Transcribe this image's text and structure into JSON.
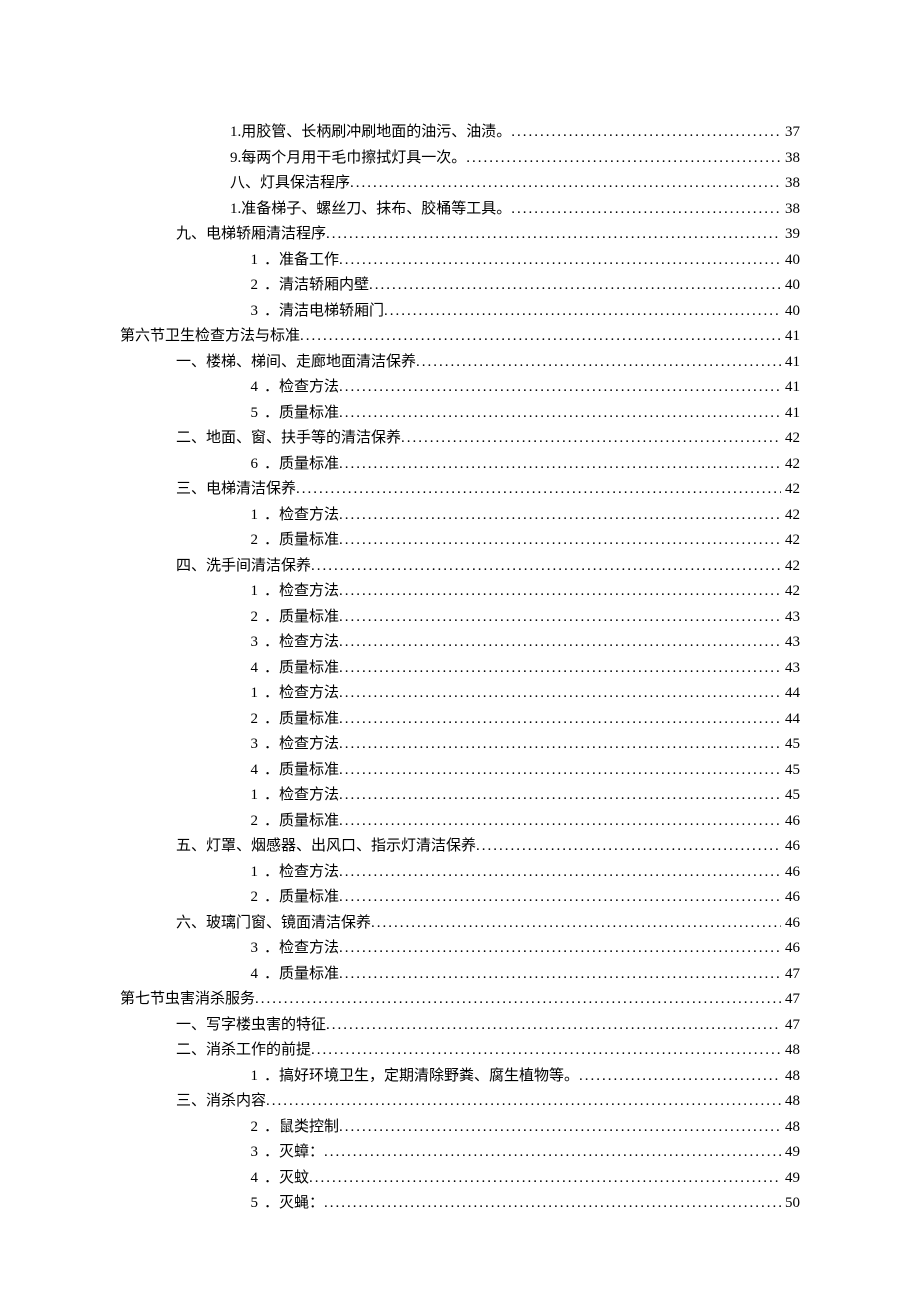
{
  "toc": [
    {
      "level": "lv2",
      "num": "",
      "label": "1.用胶管、长柄刷冲刷地面的油污、油渍。",
      "page": "37"
    },
    {
      "level": "lv2",
      "num": "",
      "label": "9.每两个月用干毛巾擦拭灯具一次。",
      "page": "38"
    },
    {
      "level": "lv2",
      "num": "",
      "label": "八、灯具保洁程序",
      "page": "38"
    },
    {
      "level": "lv2",
      "num": "",
      "label": "1.准备梯子、螺丝刀、抹布、胶桶等工具。",
      "page": "38"
    },
    {
      "level": "lv1",
      "num": "",
      "label": "九、电梯轿厢清洁程序",
      "page": "39"
    },
    {
      "level": "lv2n",
      "num": "1",
      "label": "．准备工作",
      "page": "40"
    },
    {
      "level": "lv2n",
      "num": "2",
      "label": "．清洁轿厢内壁",
      "page": "40"
    },
    {
      "level": "lv2n",
      "num": "3",
      "label": "．清洁电梯轿厢门",
      "page": "40"
    },
    {
      "level": "lv0",
      "num": "",
      "label": "第六节卫生检查方法与标准",
      "page": "41"
    },
    {
      "level": "lv1",
      "num": "",
      "label": "一、楼梯、梯间、走廊地面清洁保养",
      "page": "41"
    },
    {
      "level": "lv2n",
      "num": "4",
      "label": "．检查方法",
      "page": "41"
    },
    {
      "level": "lv2n",
      "num": "5",
      "label": "．质量标准",
      "page": "41"
    },
    {
      "level": "lv1",
      "num": "",
      "label": "二、地面、窗、扶手等的清洁保养",
      "page": "42"
    },
    {
      "level": "lv2n",
      "num": "6",
      "label": "．质量标准",
      "page": "42"
    },
    {
      "level": "lv1",
      "num": "",
      "label": "三、电梯清洁保养",
      "page": "42"
    },
    {
      "level": "lv2n",
      "num": "1",
      "label": "．检查方法",
      "page": "42"
    },
    {
      "level": "lv2n",
      "num": "2",
      "label": "．质量标准",
      "page": "42"
    },
    {
      "level": "lv1",
      "num": "",
      "label": "四、洗手间清洁保养",
      "page": "42"
    },
    {
      "level": "lv2n",
      "num": "1",
      "label": "．检查方法",
      "page": "42"
    },
    {
      "level": "lv2n",
      "num": "2",
      "label": "．质量标准",
      "page": "43"
    },
    {
      "level": "lv2n",
      "num": "3",
      "label": "．检查方法",
      "page": "43"
    },
    {
      "level": "lv2n",
      "num": "4",
      "label": "．质量标准",
      "page": "43"
    },
    {
      "level": "lv2n",
      "num": "1",
      "label": "．检查方法",
      "page": "44"
    },
    {
      "level": "lv2n",
      "num": "2",
      "label": "．质量标准",
      "page": "44"
    },
    {
      "level": "lv2n",
      "num": "3",
      "label": "．检查方法",
      "page": "45"
    },
    {
      "level": "lv2n",
      "num": "4",
      "label": "．质量标准",
      "page": "45"
    },
    {
      "level": "lv2n",
      "num": "1",
      "label": "．检查方法",
      "page": "45"
    },
    {
      "level": "lv2n",
      "num": "2",
      "label": "．质量标准",
      "page": "46"
    },
    {
      "level": "lv1",
      "num": "",
      "label": "五、灯罩、烟感器、出风口、指示灯清洁保养",
      "page": "46"
    },
    {
      "level": "lv2n",
      "num": "1",
      "label": "．检查方法",
      "page": "46"
    },
    {
      "level": "lv2n",
      "num": "2",
      "label": "．质量标准",
      "page": "46"
    },
    {
      "level": "lv1",
      "num": "",
      "label": "六、玻璃门窗、镜面清洁保养",
      "page": "46"
    },
    {
      "level": "lv2n",
      "num": "3",
      "label": "．检查方法",
      "page": "46"
    },
    {
      "level": "lv2n",
      "num": "4",
      "label": "．质量标准",
      "page": "47"
    },
    {
      "level": "lv0",
      "num": "",
      "label": "第七节虫害消杀服务",
      "page": "47"
    },
    {
      "level": "lv1",
      "num": "",
      "label": "一、写字楼虫害的特征",
      "page": "47"
    },
    {
      "level": "lv1",
      "num": "",
      "label": "二、消杀工作的前提",
      "page": "48"
    },
    {
      "level": "lv2n",
      "num": "1",
      "label": "．搞好环境卫生，定期清除野粪、腐生植物等。",
      "page": "48"
    },
    {
      "level": "lv1",
      "num": "",
      "label": "三、消杀内容",
      "page": "48"
    },
    {
      "level": "lv2n",
      "num": "2",
      "label": "．鼠类控制",
      "page": "48"
    },
    {
      "level": "lv2n",
      "num": "3",
      "label": "．灭蟑：",
      "page": "49"
    },
    {
      "level": "lv2n",
      "num": "4",
      "label": "．灭蚊",
      "page": "49"
    },
    {
      "level": "lv2n",
      "num": "5",
      "label": "．灭蝇：",
      "page": "50"
    }
  ]
}
